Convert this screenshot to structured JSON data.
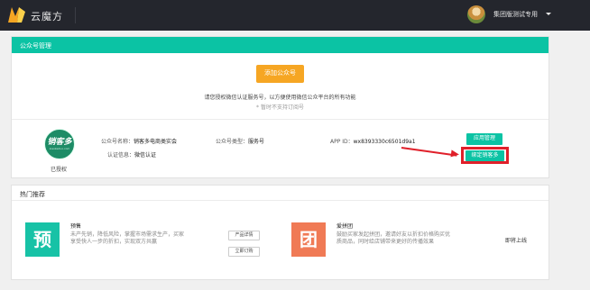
{
  "app": {
    "logo_text": "云魔方"
  },
  "user": {
    "name": "集团版测试专用"
  },
  "account_panel": {
    "title": "公众号管理",
    "add_button": "添加公众号",
    "tip": "请您授权微信认证服务号，以方便使用微信公众平台的所有功能",
    "sub_tip": "* 暂时不支持订阅号",
    "account": {
      "logo_text": "销客多",
      "logo_subtext": "xiaokeduo.com",
      "status": "已授权",
      "name_label": "公众号名称：",
      "name_value": "销客多电商类实会",
      "type_label": "公众号类型：",
      "type_value": "服务号",
      "appid_label": "APP ID：",
      "appid_value": "wx8393330c6501d9a1",
      "auth_label": "认证信息：",
      "auth_value": "微信认证",
      "manage_button": "应用管理",
      "bind_button": "绑定销客多"
    }
  },
  "recommend_panel": {
    "title": "热门推荐",
    "items": [
      {
        "icon_char": "预",
        "icon_color": "#17c2a6",
        "title": "预售",
        "desc_line1": "未产先销，降低风险，掌握市场需求生产，买家",
        "desc_line2": "享受快人一步的折扣，实现双方共赢",
        "detail_button": "产品详情",
        "order_button": "立即订购"
      },
      {
        "icon_char": "团",
        "icon_color": "#f07a55",
        "title": "爱拼团",
        "desc_line1": "鼓励买家发起拼团，邀请好友以折扣价格购买优",
        "desc_line2": "质商品，同时给店铺带来更好的传播效果",
        "status": "即将上线"
      }
    ]
  },
  "colors": {
    "accent": "#0bc3a4",
    "topbar": "#24262d",
    "add_button": "#f6a623",
    "highlight": "#e0202a"
  }
}
